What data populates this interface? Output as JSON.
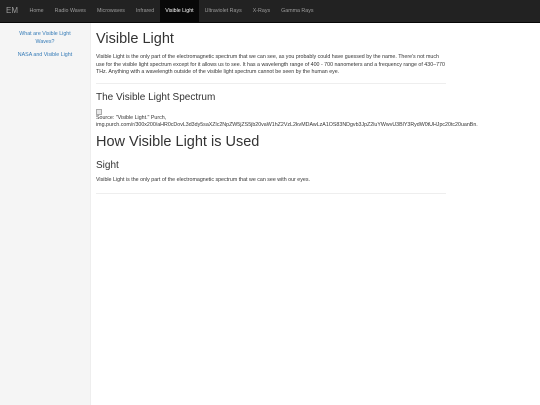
{
  "navbar": {
    "brand": "EM",
    "items": [
      {
        "label": "Home"
      },
      {
        "label": "Radio Waves"
      },
      {
        "label": "Microwaves"
      },
      {
        "label": "Infrared"
      },
      {
        "label": "Visible Light",
        "active": true
      },
      {
        "label": "Ultraviolet Rays"
      },
      {
        "label": "X-Rays"
      },
      {
        "label": "Gamma Rays"
      }
    ]
  },
  "sidebar": {
    "links": [
      {
        "label": "What are Visible Light Waves?"
      },
      {
        "label": "NASA and Visible Light"
      }
    ]
  },
  "main": {
    "title": "Visible Light",
    "intro": "Visible Light is the only part of the electromagnetic spectrum that we can see, as you probably could have guessed by the name. There's not much use for the visible light spectrum except for it allows us to see. It has a wavelength range of 400 - 700 nanometers and a frequency range of 430–770 THz. Anything with a wavelength outside of the visible light spectrum cannot be seen by the human eye.",
    "spectrum_heading": "The Visible Light Spectrum",
    "source_line1": "Source: \"Visible Light.\" Purch,",
    "source_line2": "img.purch.com/r/300x200/aHR0cDovL3d3dy5saXZlc2NpZW5jZS5jb20vaW1hZ2VzL2kvMDAwLzA1OS83NDgvb3JpZ2luYWwvU3BlY3RydW0tUHJpc20tc20uanBn.",
    "used_heading": "How Visible Light is Used",
    "sight_heading": "Sight",
    "sight_text": "Visible Light is the only part of the electromagnetic spectrum that we can see with our eyes."
  },
  "colors": {
    "navbar_bg": "#222222",
    "nav_active_bg": "#080808",
    "link": "#337ab7",
    "sidebar_bg": "#f5f5f5"
  }
}
